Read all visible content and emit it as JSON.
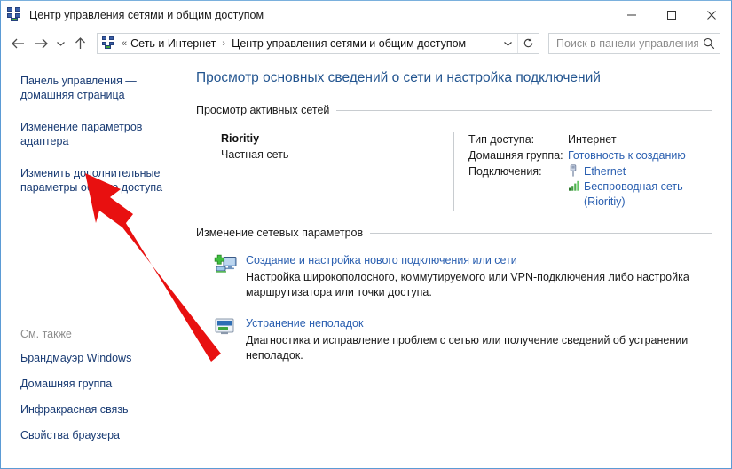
{
  "window": {
    "title": "Центр управления сетями и общим доступом",
    "icon": "network-sharing-icon",
    "minimize_label": "—",
    "maximize_label": "□",
    "close_label": "✕"
  },
  "navbar": {
    "back_label": "Назад",
    "forward_label": "Вперед",
    "history_label": "Последние страницы",
    "up_label": "Вверх",
    "breadcrumb_prefix": "«",
    "breadcrumb": [
      {
        "label": "Сеть и Интернет"
      },
      {
        "label": "Центр управления сетями и общим доступом"
      }
    ],
    "breadcrumb_separator": "›",
    "dropdown_label": "⌄",
    "refresh_label": "↻"
  },
  "search": {
    "placeholder": "Поиск в панели управления",
    "value": "",
    "icon": "search-icon"
  },
  "sidebar": {
    "items": [
      {
        "label": "Панель управления — домашняя страница"
      },
      {
        "label": "Изменение параметров адаптера"
      },
      {
        "label": "Изменить дополнительные параметры общего доступа"
      }
    ],
    "see_also": {
      "title": "См. также",
      "items": [
        {
          "label": "Брандмауэр Windows"
        },
        {
          "label": "Домашняя группа"
        },
        {
          "label": "Инфракрасная связь"
        },
        {
          "label": "Свойства браузера"
        }
      ]
    }
  },
  "main": {
    "page_title": "Просмотр основных сведений о сети и настройка подключений",
    "active_networks": {
      "heading": "Просмотр активных сетей",
      "network_name": "Rioritiy",
      "network_type": "Частная сеть",
      "rows": [
        {
          "label": "Тип доступа:",
          "value": "Интернет"
        },
        {
          "label": "Домашняя группа:",
          "value": "Готовность к созданию"
        },
        {
          "label": "Подключения:",
          "value": ""
        }
      ],
      "connections": [
        {
          "label": "Ethernet",
          "icon": "ethernet-plug-icon"
        },
        {
          "label": "Беспроводная сеть (Rioritiy)",
          "icon": "wifi-signal-icon"
        }
      ]
    },
    "network_settings": {
      "heading": "Изменение сетевых параметров",
      "items": [
        {
          "icon": "new-connection-icon",
          "link": "Создание и настройка нового подключения или сети",
          "description": "Настройка широкополосного, коммутируемого или VPN-подключения либо настройка маршрутизатора или точки доступа."
        },
        {
          "icon": "troubleshoot-icon",
          "link": "Устранение неполадок",
          "description": "Диагностика и исправление проблем с сетью или получение сведений об устранении неполадок."
        }
      ]
    }
  },
  "annotation": {
    "type": "arrow",
    "color": "#e81010",
    "points_to": "Изменить дополнительные параметры общего доступа"
  },
  "colors": {
    "title_link": "#22548f",
    "link": "#2a5fb0",
    "sidebar_link": "#1a3c74",
    "window_border": "#5b9bd5",
    "rule": "#c8ccd0",
    "arrow_red": "#e81010"
  }
}
